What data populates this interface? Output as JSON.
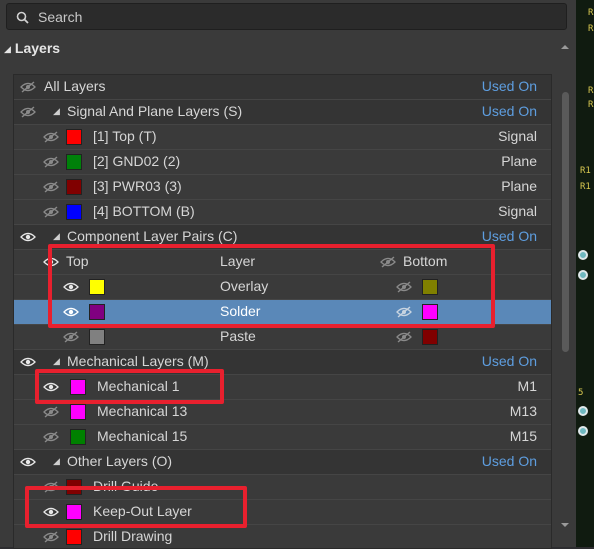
{
  "search": {
    "placeholder": "Search"
  },
  "panel_title": "Layers",
  "rows": [
    {
      "label": "All Layers",
      "right": "Used On",
      "right_blue": true
    },
    {
      "label": "Signal And Plane Layers (S)",
      "right": "Used On",
      "right_blue": true
    },
    {
      "label": "[1] Top (T)",
      "right": "Signal",
      "color": "#ff0000"
    },
    {
      "label": "[2] GND02 (2)",
      "right": "Plane",
      "color": "#00800a"
    },
    {
      "label": "[3] PWR03 (3)",
      "right": "Plane",
      "color": "#800000"
    },
    {
      "label": "[4] BOTTOM (B)",
      "right": "Signal",
      "color": "#0000ff"
    },
    {
      "label": "Component Layer Pairs (C)",
      "right": "Used On",
      "right_blue": true
    },
    {
      "col_top": "Top",
      "col_layer": "Layer",
      "col_bottom": "Bottom"
    },
    {
      "label": "Overlay",
      "top_color": "#ffff00",
      "bottom_color": "#808000"
    },
    {
      "label": "Solder",
      "top_color": "#800080",
      "bottom_color": "#ff00ff"
    },
    {
      "label": "Paste",
      "top_color": "#808080",
      "bottom_color": "#800000"
    },
    {
      "label": "Mechanical Layers (M)",
      "right": "Used On",
      "right_blue": true
    },
    {
      "label": "Mechanical 1",
      "right": "M1",
      "color": "#ff00ff"
    },
    {
      "label": "Mechanical 13",
      "right": "M13",
      "color": "#ff00ff"
    },
    {
      "label": "Mechanical 15",
      "right": "M15",
      "color": "#008000"
    },
    {
      "label": "Other Layers (O)",
      "right": "Used On",
      "right_blue": true
    },
    {
      "label": "Drill Guide",
      "color": "#800000"
    },
    {
      "label": "Keep-Out Layer",
      "color": "#ff00ff"
    },
    {
      "label": "Drill Drawing",
      "color": "#ff0000"
    }
  ],
  "right_strip": {
    "labels": [
      "R",
      "R",
      "R",
      "R",
      "R1",
      "R1",
      "5"
    ]
  }
}
